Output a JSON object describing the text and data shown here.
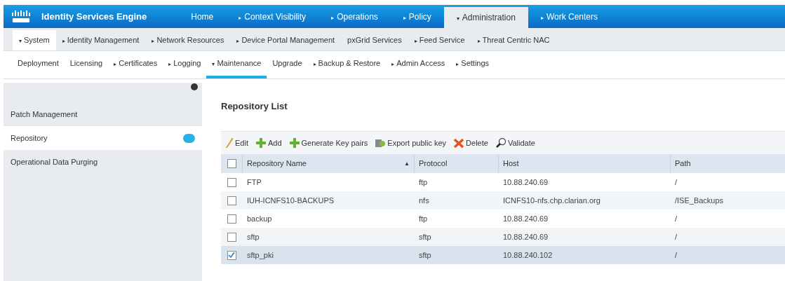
{
  "header": {
    "product": "Identity Services Engine",
    "tabs": [
      {
        "label": "Home",
        "selected": false
      },
      {
        "label": "Context Visibility",
        "arrow": "▸",
        "selected": false
      },
      {
        "label": "Operations",
        "arrow": "▸",
        "selected": false
      },
      {
        "label": "Policy",
        "arrow": "▸",
        "selected": false
      },
      {
        "label": "Administration",
        "arrow": "▾",
        "selected": true
      },
      {
        "label": "Work Centers",
        "arrow": "▸",
        "selected": false
      }
    ]
  },
  "subnav": [
    {
      "label": "System",
      "arrow": "▾",
      "selected": true
    },
    {
      "label": "Identity Management",
      "arrow": "▸",
      "selected": false
    },
    {
      "label": "Network Resources",
      "arrow": "▸",
      "selected": false
    },
    {
      "label": "Device Portal Management",
      "arrow": "▸",
      "selected": false
    },
    {
      "label": "pxGrid Services",
      "selected": false
    },
    {
      "label": "Feed Service",
      "arrow": "▸",
      "selected": false
    },
    {
      "label": "Threat Centric NAC",
      "arrow": "▸",
      "selected": false
    }
  ],
  "thirdnav": [
    {
      "label": "Deployment",
      "selected": false
    },
    {
      "label": "Licensing",
      "selected": false
    },
    {
      "label": "Certificates",
      "arrow": "▸",
      "selected": false
    },
    {
      "label": "Logging",
      "arrow": "▸",
      "selected": false
    },
    {
      "label": "Maintenance",
      "arrow": "▾",
      "selected": true
    },
    {
      "label": "Upgrade",
      "selected": false
    },
    {
      "label": "Backup & Restore",
      "arrow": "▸",
      "selected": false
    },
    {
      "label": "Admin Access",
      "arrow": "▸",
      "selected": false
    },
    {
      "label": "Settings",
      "arrow": "▸",
      "selected": false
    }
  ],
  "sidebar": {
    "items": [
      {
        "label": "Patch Management",
        "selected": false
      },
      {
        "label": "Repository",
        "selected": true
      },
      {
        "label": "Operational Data Purging",
        "selected": false
      }
    ]
  },
  "content": {
    "title": "Repository List",
    "toolbar": [
      {
        "kind": "edit",
        "label": "Edit"
      },
      {
        "kind": "add",
        "label": "Add"
      },
      {
        "kind": "add",
        "label": "Generate Key pairs"
      },
      {
        "kind": "export",
        "label": "Export public key"
      },
      {
        "kind": "delete",
        "label": "Delete"
      },
      {
        "kind": "validate",
        "label": "Validate"
      }
    ],
    "table": {
      "select_all": {
        "checked": false
      },
      "columns": [
        {
          "label": "Repository Name",
          "sort": "▲"
        },
        {
          "label": "Protocol"
        },
        {
          "label": "Host"
        },
        {
          "label": "Path"
        }
      ],
      "rows": [
        {
          "checked": false,
          "selected": false,
          "cells": [
            "FTP",
            "ftp",
            "10.88.240.69",
            "/"
          ]
        },
        {
          "checked": false,
          "selected": false,
          "cells": [
            "IUH-ICNFS10-BACKUPS",
            "nfs",
            "ICNFS10-nfs.chp.clarian.org",
            "/ISE_Backups"
          ]
        },
        {
          "checked": false,
          "selected": false,
          "cells": [
            "backup",
            "ftp",
            "10.88.240.69",
            "/"
          ]
        },
        {
          "checked": false,
          "selected": false,
          "cells": [
            "sftp",
            "sftp",
            "10.88.240.69",
            "/"
          ]
        },
        {
          "checked": true,
          "selected": true,
          "cells": [
            "sftp_pki",
            "sftp",
            "10.88.240.102",
            "/"
          ]
        }
      ]
    }
  }
}
